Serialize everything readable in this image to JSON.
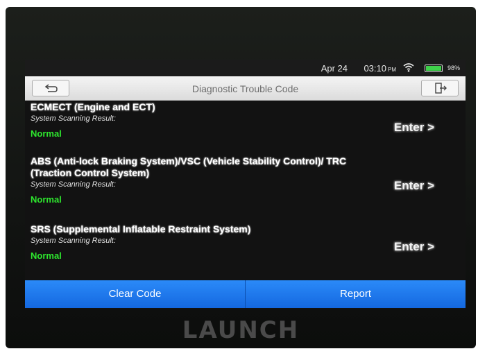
{
  "status_bar": {
    "date": "Apr 24",
    "time": "03:10",
    "ampm": "PM",
    "battery_percent": "98%",
    "battery_level": 0.98,
    "wifi_icon": "wifi-icon"
  },
  "header": {
    "title": "Diagnostic Trouble Code",
    "back_icon": "back-arrow-icon",
    "exit_icon": "exit-icon"
  },
  "systems": [
    {
      "name": "ECMECT (Engine and ECT)",
      "result_label": "System Scanning Result:",
      "result": "Normal",
      "enter_label": "Enter >"
    },
    {
      "name": "ABS (Anti-lock Braking System)/VSC (Vehicle Stability Control)/ TRC (Traction Control System)",
      "result_label": "System Scanning Result:",
      "result": "Normal",
      "enter_label": "Enter >"
    },
    {
      "name": "SRS (Supplemental Inflatable Restraint System)",
      "result_label": "System Scanning Result:",
      "result": "Normal",
      "enter_label": "Enter >"
    }
  ],
  "actions": {
    "clear_code": "Clear Code",
    "report": "Report"
  },
  "device": {
    "brand": "LAUNCH"
  },
  "colors": {
    "accent_blue": "#1877f0",
    "normal_green": "#2ee62e",
    "battery_green": "#3fd14b",
    "screen_bg": "#121212"
  }
}
